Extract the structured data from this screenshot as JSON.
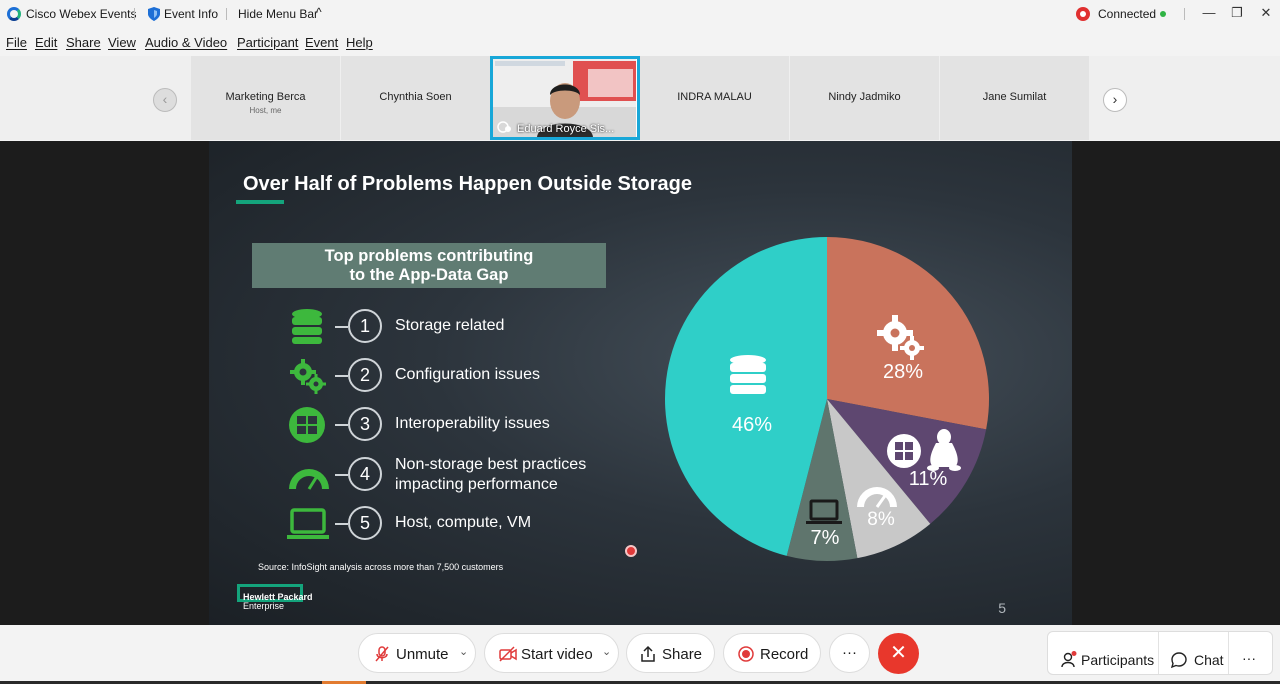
{
  "titlebar": {
    "app_name": "Cisco Webex Events",
    "event_info": "Event Info",
    "hide_menu_bar": "Hide Menu Bar",
    "hide_menu_caret": "^",
    "status": "Connected",
    "minimize": "—",
    "restore": "❐",
    "close": "✕"
  },
  "menu": [
    "File",
    "Edit",
    "Share",
    "View",
    "Audio & Video",
    "Participant",
    "Event",
    "Help"
  ],
  "participants_strip": {
    "prev": "‹",
    "next": "›",
    "tiles": [
      {
        "name": "Marketing Berca",
        "sub": "Host, me"
      },
      {
        "name": "Chynthia Soen",
        "sub": ""
      },
      {
        "name": "Eduard Royce Sis...",
        "sub": ""
      },
      {
        "name": "INDRA MALAU",
        "sub": ""
      },
      {
        "name": "Nindy Jadmiko",
        "sub": ""
      },
      {
        "name": "Jane Sumilat",
        "sub": ""
      }
    ]
  },
  "slide": {
    "title": "Over Half of Problems Happen Outside Storage",
    "header_line1": "Top problems contributing",
    "header_line2": "to the App-Data Gap",
    "items": [
      {
        "num": "1",
        "label": "Storage related",
        "icon": "database-icon"
      },
      {
        "num": "2",
        "label": "Configuration issues",
        "icon": "gears-icon"
      },
      {
        "num": "3",
        "label": "Interoperability issues",
        "icon": "windows-icon"
      },
      {
        "num": "4",
        "label_line1": "Non-storage best practices",
        "label_line2": "impacting performance",
        "icon": "gauge-icon"
      },
      {
        "num": "5",
        "label": "Host, compute, VM",
        "icon": "laptop-icon"
      }
    ],
    "source": "Source: InfoSight analysis across more than 7,500 customers",
    "brand_line1": "Hewlett Packard",
    "brand_line2": "Enterprise",
    "page_number": "5",
    "accent_color": "#14a47c"
  },
  "chart_data": {
    "type": "pie",
    "slices": [
      {
        "label": "Configuration issues",
        "value": 28,
        "text": "28%",
        "color": "#c9735c"
      },
      {
        "label": "Interoperability issues",
        "value": 11,
        "text": "11%",
        "color": "#5e4770"
      },
      {
        "label": "Non-storage best practices",
        "value": 8,
        "text": "8%",
        "color": "#c8c8c8"
      },
      {
        "label": "Host, compute, VM",
        "value": 7,
        "text": "7%",
        "color": "#5f756d"
      },
      {
        "label": "Storage related",
        "value": 46,
        "text": "46%",
        "color": "#2fcfc8"
      }
    ]
  },
  "toolbar": {
    "unmute": "Unmute",
    "start_video": "Start video",
    "share": "Share",
    "record": "Record",
    "more": "···",
    "end": "✕",
    "participants": "Participants",
    "chat": "Chat",
    "more_right": "···"
  }
}
